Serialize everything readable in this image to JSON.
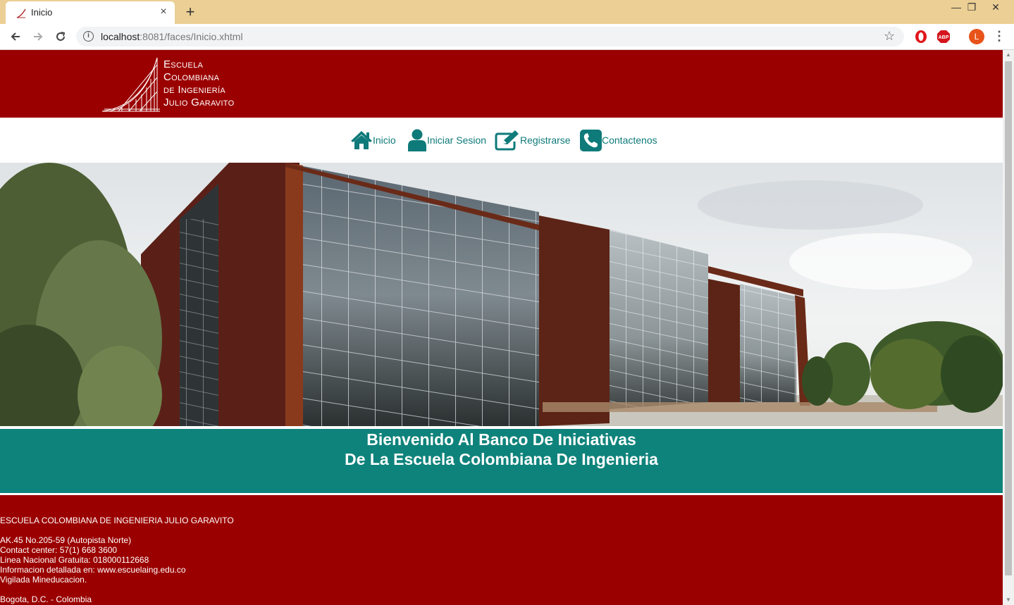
{
  "browser": {
    "tab_title": "Inicio",
    "tab_close": "×",
    "new_tab": "+",
    "url_host": "localhost",
    "url_rest": ":8081/faces/Inicio.xhtml",
    "avatar_letter": "L",
    "abp_label": "ABP",
    "window_controls": {
      "minimize": "—",
      "maximize": "❐",
      "close": "✕"
    }
  },
  "header": {
    "logo_lines": [
      "Escuela",
      "Colombiana",
      "de Ingeniería",
      "Julio Garavito"
    ]
  },
  "nav": {
    "items": [
      {
        "label": "Inicio",
        "icon": "home-icon"
      },
      {
        "label": "Iniciar Sesion",
        "icon": "user-icon"
      },
      {
        "label": "Registrarse",
        "icon": "edit-icon"
      },
      {
        "label": "Contactenos",
        "icon": "phone-icon"
      }
    ]
  },
  "welcome": {
    "line1": "Bienvenido Al Banco De Iniciativas",
    "line2": "De La Escuela Colombiana De Ingenieria"
  },
  "footer": {
    "name": "ESCUELA COLOMBIANA DE INGENIERIA JULIO GARAVITO",
    "address": "AK.45 No.205-59 (Autopista Norte)",
    "contact": "Contact center: 57(1) 668 3600",
    "toll_free": "Linea Nacional Gratuita: 018000112668",
    "info": "Informacion detallada en: www.escuelaing.edu.co",
    "vigilada": "Vigilada Mineducacion.",
    "city": "Bogota, D.C. - Colombia"
  },
  "colors": {
    "brand_red": "#9b0000",
    "teal": "#0e837b",
    "nav_teal": "#0f7a7a",
    "chrome": "#ebcf94"
  }
}
